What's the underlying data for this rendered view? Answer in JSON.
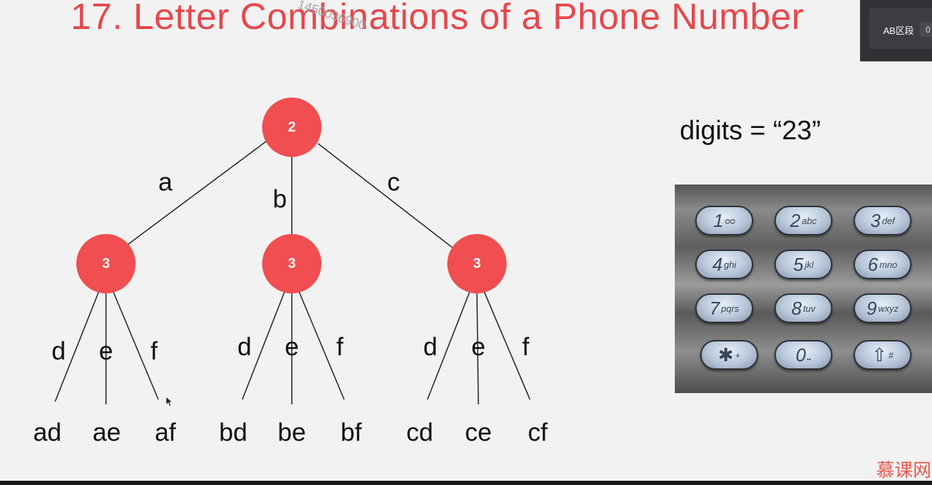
{
  "title": "17. Letter Combinations of a Phone Number",
  "watermark": "1450036900",
  "overlay": {
    "label": "AB区段",
    "value": "0"
  },
  "diagram": {
    "root": {
      "label": "2"
    },
    "root_edges": [
      "a",
      "b",
      "c"
    ],
    "children": [
      {
        "label": "3",
        "edges": [
          "d",
          "e",
          "f"
        ],
        "leaves": [
          "ad",
          "ae",
          "af"
        ]
      },
      {
        "label": "3",
        "edges": [
          "d",
          "e",
          "f"
        ],
        "leaves": [
          "bd",
          "be",
          "bf"
        ]
      },
      {
        "label": "3",
        "edges": [
          "d",
          "e",
          "f"
        ],
        "leaves": [
          "cd",
          "ce",
          "cf"
        ]
      }
    ]
  },
  "digits_text": "digits = “23”",
  "keypad": {
    "keys": [
      {
        "digit": "1",
        "letters": "ᴑᴑ"
      },
      {
        "digit": "2",
        "letters": "abc"
      },
      {
        "digit": "3",
        "letters": "def"
      },
      {
        "digit": "4",
        "letters": "ghi"
      },
      {
        "digit": "5",
        "letters": "jkl"
      },
      {
        "digit": "6",
        "letters": "mno"
      },
      {
        "digit": "7",
        "letters": "pqrs"
      },
      {
        "digit": "8",
        "letters": "tuv"
      },
      {
        "digit": "9",
        "letters": "wxyz"
      },
      {
        "digit": "✱",
        "letters": "+"
      },
      {
        "digit": "0",
        "letters": "⎵"
      },
      {
        "digit": "⇧",
        "letters": "#"
      }
    ]
  },
  "brand": "慕课网",
  "colors": {
    "node": "#f04e50",
    "title": "#e5484d"
  }
}
